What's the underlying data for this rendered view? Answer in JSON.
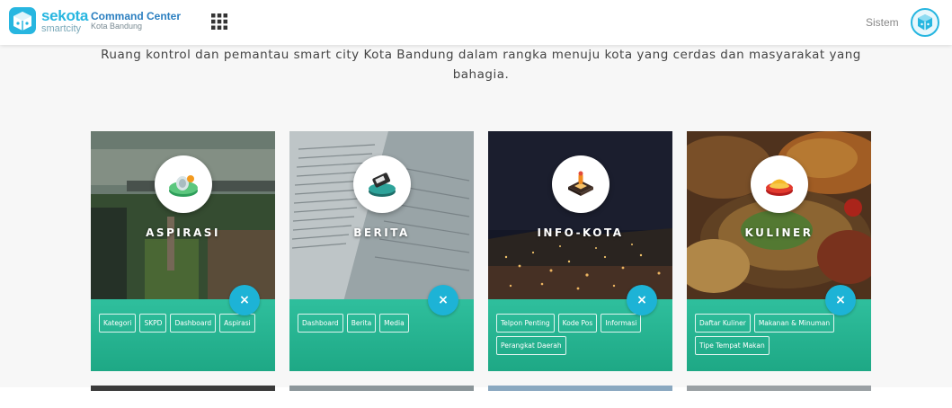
{
  "header": {
    "brand_top": "sekota",
    "brand_bottom": "smartcity",
    "app_title": "Command Center",
    "app_subtitle": "Kota Bandung",
    "user_label": "Sistem"
  },
  "main": {
    "tagline": "Ruang kontrol dan pemantau smart city Kota Bandung dalam rangka menuju kota yang cerdas dan masyarakat yang bahagia."
  },
  "cards": [
    {
      "title": "ASPIRASI",
      "close": "×",
      "tags": [
        "Kategori",
        "SKPD",
        "Dashboard",
        "Aspirasi"
      ]
    },
    {
      "title": "BERITA",
      "close": "×",
      "tags": [
        "Dashboard",
        "Berita",
        "Media"
      ]
    },
    {
      "title": "INFO-KOTA",
      "close": "×",
      "tags": [
        "Telpon Penting",
        "Kode Pos",
        "Informasi",
        "Perangkat Daerah"
      ]
    },
    {
      "title": "KULINER",
      "close": "×",
      "tags": [
        "Daftar Kuliner",
        "Makanan & Minuman",
        "Tipe Tempat Makan"
      ]
    }
  ],
  "colors": {
    "accent": "#27b6e0",
    "panel": "#2fbf9d",
    "close_button": "#1db3d6"
  },
  "icons": [
    "logo-cube-icon",
    "apps-grid-icon",
    "user-avatar-icon",
    "aspirasi-icon",
    "berita-icon",
    "info-kota-icon",
    "kuliner-icon",
    "close-icon"
  ]
}
